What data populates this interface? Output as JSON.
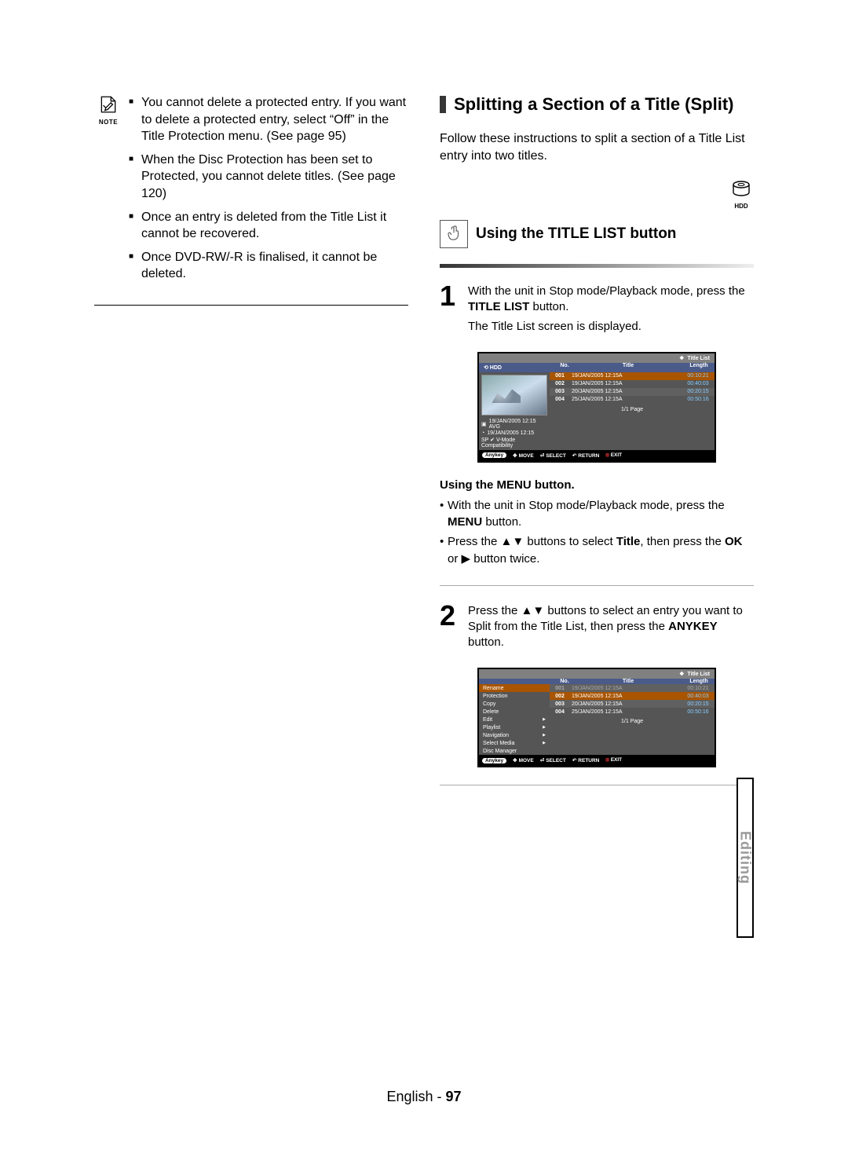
{
  "left": {
    "note_label": "NOTE",
    "notes": [
      "You cannot delete a protected entry. If you want to delete a protected entry, select “Off” in the Title Protection menu. (See page 95)",
      "When the Disc Protection has been set to Protected, you cannot delete titles. (See page 120)",
      "Once an entry is deleted from the Title List it cannot be recovered.",
      "Once DVD-RW/-R is finalised, it cannot be deleted."
    ]
  },
  "right": {
    "section_title": "Splitting a Section of a Title (Split)",
    "intro": "Follow these instructions to split a section of a Title List entry into two titles.",
    "hdd_label": "HDD",
    "sub_title": "Using the TITLE LIST button",
    "step1": {
      "num": "1",
      "l1a": "With the unit in Stop mode/Playback mode, press the ",
      "l1b": "TITLE LIST",
      "l1c": " button.",
      "l2": "The Title List screen is displayed."
    },
    "menu_sub": {
      "heading": "Using the MENU button.",
      "b1a": "With the unit in Stop mode/Playback mode, press the ",
      "b1b": "MENU",
      "b1c": " button.",
      "b2a": "Press the ",
      "b2b": "▲▼",
      "b2c": " buttons to select ",
      "b2d": "Title",
      "b2e": ", then press the ",
      "b2f": "OK",
      "b2g": " or ",
      "b2h": "▶",
      "b2i": " button twice."
    },
    "step2": {
      "num": "2",
      "l1a": "Press the ",
      "l1b": "▲▼",
      "l1c": " buttons to select an entry you want to Split from the Title List, then press the ",
      "l1d": "ANYKEY",
      "l1e": " button."
    }
  },
  "osd1": {
    "top": "Title List",
    "hdd": "HDD",
    "cols": {
      "no": "No.",
      "title": "Title",
      "length": "Length"
    },
    "meta1": "19/JAN/2005 12:15 AVG",
    "meta2": "19/JAN/2005 12:15",
    "meta3": "SP ✔ V-Mode Compatibility",
    "rows": [
      {
        "no": "001",
        "title": "19/JAN/2005 12:15A",
        "len": "00:10:21"
      },
      {
        "no": "002",
        "title": "19/JAN/2005 12:15A",
        "len": "00:40:03"
      },
      {
        "no": "003",
        "title": "20/JAN/2005 12:15A",
        "len": "00:20:15"
      },
      {
        "no": "004",
        "title": "25/JAN/2005 12:15A",
        "len": "00:50:16"
      }
    ],
    "page": "1/1 Page",
    "footer": {
      "anykey": "Anykey",
      "move": "MOVE",
      "select": "SELECT",
      "return": "RETURN",
      "exit": "EXIT"
    }
  },
  "osd2": {
    "top": "Title List",
    "cols": {
      "no": "No.",
      "title": "Title",
      "length": "Length"
    },
    "menu": [
      "Rename",
      "Protection",
      "Copy",
      "Delete",
      "Edit",
      "Playlist",
      "Navigation",
      "Select Media",
      "Disc Manager"
    ],
    "arrows": [
      "Edit",
      "Playlist",
      "Navigation",
      "Select Media"
    ],
    "rows": [
      {
        "no": "001",
        "title": "19/JAN/2005 12:15A",
        "len": "00:10:21"
      },
      {
        "no": "002",
        "title": "19/JAN/2005 12:15A",
        "len": "00:40:03"
      },
      {
        "no": "003",
        "title": "20/JAN/2005 12:15A",
        "len": "00:20:15"
      },
      {
        "no": "004",
        "title": "25/JAN/2005 12:15A",
        "len": "00:50:16"
      }
    ],
    "page": "1/1 Page",
    "footer": {
      "anykey": "Anykey",
      "move": "MOVE",
      "select": "SELECT",
      "return": "RETURN",
      "exit": "EXIT"
    }
  },
  "side_tab": "Editing",
  "footer": {
    "lang": "English",
    "sep": " - ",
    "page": "97"
  }
}
